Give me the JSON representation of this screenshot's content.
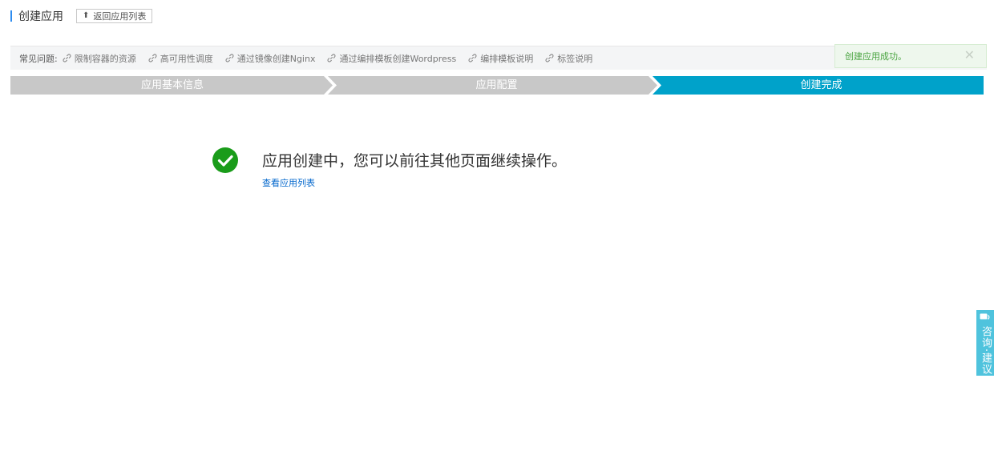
{
  "header": {
    "title": "创建应用",
    "back_label": "返回应用列表",
    "back_icon": "arrow-up-icon"
  },
  "faq": {
    "label": "常见问题:",
    "links": [
      "限制容器的资源",
      "高可用性调度",
      "通过镜像创建Nginx",
      "通过编排模板创建Wordpress",
      "编排模板说明",
      "标签说明"
    ]
  },
  "toast": {
    "message": "创建应用成功。",
    "close_glyph": "✕"
  },
  "steps": {
    "items": [
      "应用基本信息",
      "应用配置",
      "创建完成"
    ],
    "active_index": 2,
    "colors": {
      "inactive": "#c8c8c8",
      "active": "#00a2ca",
      "separator": "#ffffff"
    }
  },
  "result": {
    "icon": "check-circle-icon",
    "icon_color": "#1a9c1a",
    "message": "应用创建中，您可以前往其他页面继续操作。",
    "link": "查看应用列表"
  },
  "side_tab": {
    "label": "咨询·建议",
    "icon": "chat-icon",
    "color": "#4fc3dd"
  }
}
